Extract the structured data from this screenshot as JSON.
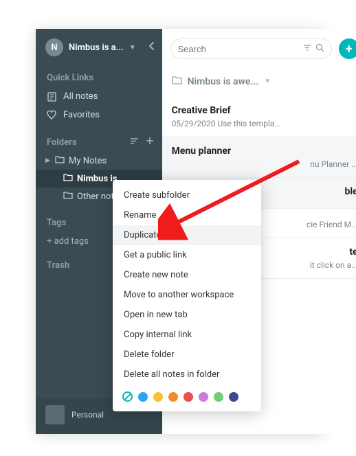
{
  "header": {
    "avatar_initial": "N",
    "workspace": "Nimbus is a..."
  },
  "sidebar": {
    "quick_links_title": "Quick Links",
    "all_notes": "All notes",
    "favorites": "Favorites",
    "folders_title": "Folders",
    "folders": {
      "my_notes": "My Notes",
      "nimbus_is": "Nimbus is",
      "other_notes": "Other note"
    },
    "tags_title": "Tags",
    "add_tags": "+ add tags",
    "trash_title": "Trash",
    "footer_label": "Personal"
  },
  "main": {
    "search_placeholder": "Search",
    "breadcrumb": "Nimbus is awe...",
    "notes": [
      {
        "title": "Creative Brief",
        "snippet": "05/29/2020 Use this templa..."
      },
      {
        "title": "Menu planner",
        "snippet": "nu Planner ..."
      },
      {
        "title": "ble",
        "snippet": ""
      },
      {
        "title": "",
        "snippet": "cie Friend M..."
      },
      {
        "title": "te",
        "snippet": "it click on a..."
      }
    ]
  },
  "ctx": {
    "items": [
      "Create subfolder",
      "Rename",
      "Duplicate",
      "Get a public link",
      "Create new note",
      "Move to another workspace",
      "Open in new tab",
      "Copy internal link",
      "Delete folder",
      "Delete all notes in folder"
    ],
    "colors": [
      "#2aa7ee",
      "#f9c22e",
      "#f58b2e",
      "#ea4e4e",
      "#c77dd9",
      "#6fcf7a",
      "#3b4a8c"
    ]
  }
}
